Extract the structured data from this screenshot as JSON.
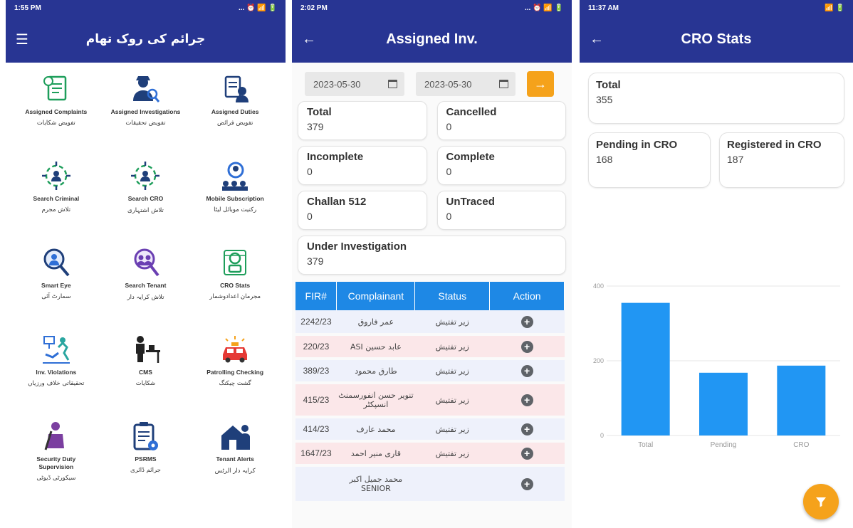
{
  "screen1": {
    "time": "1:55 PM",
    "status_icons": "... ⏰ 📶 🔋",
    "title": "جرائم کی روک تھام",
    "items": [
      {
        "en": "Assigned Complaints",
        "ur": "تفویض شکایات",
        "icon": "complaint-icon"
      },
      {
        "en": "Assigned Investigations",
        "ur": "تفویض تحقیقات",
        "icon": "investigator-icon"
      },
      {
        "en": "Assigned Duties",
        "ur": "تفویض فرائض",
        "icon": "duty-icon"
      },
      {
        "en": "Search Criminal",
        "ur": "تلاش مجرم",
        "icon": "target-person-icon"
      },
      {
        "en": "Search CRO",
        "ur": "تلاش اشتہاری",
        "icon": "target-person-icon"
      },
      {
        "en": "Mobile Subscription",
        "ur": "رکنیت موبائل لیٹا",
        "icon": "group-search-icon"
      },
      {
        "en": "Smart Eye",
        "ur": "سمارٹ آئی",
        "icon": "magnifier-person-icon"
      },
      {
        "en": "Search Tenant",
        "ur": "تلاش کرایہ دار",
        "icon": "magnifier-group-icon"
      },
      {
        "en": "CRO Stats",
        "ur": "مجرمان اعدادوشمار",
        "icon": "prisoner-icon"
      },
      {
        "en": "Inv. Violations",
        "ur": "تحقیقاتی خلاف ورزیاں",
        "icon": "violation-icon"
      },
      {
        "en": "CMS",
        "ur": "شکایات",
        "icon": "desk-officer-icon"
      },
      {
        "en": "Patrolling Checking",
        "ur": "گشت چیکنگ",
        "icon": "police-car-icon"
      },
      {
        "en": "Security Duty Supervision",
        "ur": "سیکورٹی ڈیوٹی",
        "icon": "guard-icon"
      },
      {
        "en": "PSRMS",
        "ur": "جرائم ڈائری",
        "icon": "clipboard-gear-icon"
      },
      {
        "en": "Tenant Alerts",
        "ur": "کرایہ دار الرٹس",
        "icon": "house-person-icon"
      }
    ]
  },
  "screen2": {
    "time": "2:02 PM",
    "status_icons": "... ⏰ 📶 🔋",
    "title": "Assigned Inv.",
    "date_from": "2023-05-30",
    "date_to": "2023-05-30",
    "cards": [
      {
        "label": "Total",
        "value": "379"
      },
      {
        "label": "Cancelled",
        "value": "0"
      },
      {
        "label": "Incomplete",
        "value": "0"
      },
      {
        "label": "Complete",
        "value": "0"
      },
      {
        "label": "Challan 512",
        "value": "0"
      },
      {
        "label": "UnTraced",
        "value": "0"
      },
      {
        "label": "Under Investigation",
        "value": "379"
      }
    ],
    "columns": [
      "FIR#",
      "Complainant",
      "Status",
      "Action"
    ],
    "rows": [
      {
        "fir": "2242/23",
        "complainant": "عمر فاروق",
        "status": "زیر تفتیش"
      },
      {
        "fir": "220/23",
        "complainant": "ASI عابد حسین",
        "status": "زیر تفتیش"
      },
      {
        "fir": "389/23",
        "complainant": "طارق محمود",
        "status": "زیر تفتیش"
      },
      {
        "fir": "415/23",
        "complainant": "تنویر حسن انفورسمنٹ انسپکٹر",
        "status": "زیر تفتیش"
      },
      {
        "fir": "414/23",
        "complainant": "محمد عارف",
        "status": "زیر تفتیش"
      },
      {
        "fir": "1647/23",
        "complainant": "قاری منیر احمد",
        "status": "زیر تفتیش"
      },
      {
        "fir": "",
        "complainant": "محمد جمیل اکبر SENIOR",
        "status": ""
      }
    ]
  },
  "screen3": {
    "time": "11:37 AM",
    "status_icons": "📶 🔋",
    "title": "CRO Stats",
    "cards": [
      {
        "label": "Total",
        "value": "355"
      },
      {
        "label": "Pending in CRO",
        "value": "168"
      },
      {
        "label": "Registered in CRO",
        "value": "187"
      }
    ],
    "chart_data": {
      "type": "bar",
      "categories": [
        "Total",
        "Pending",
        "CRO"
      ],
      "values": [
        355,
        168,
        187
      ],
      "ylim": [
        0,
        400
      ],
      "yticks": [
        "0",
        "200",
        "400"
      ],
      "color": "#2196f3",
      "grid": true
    }
  }
}
